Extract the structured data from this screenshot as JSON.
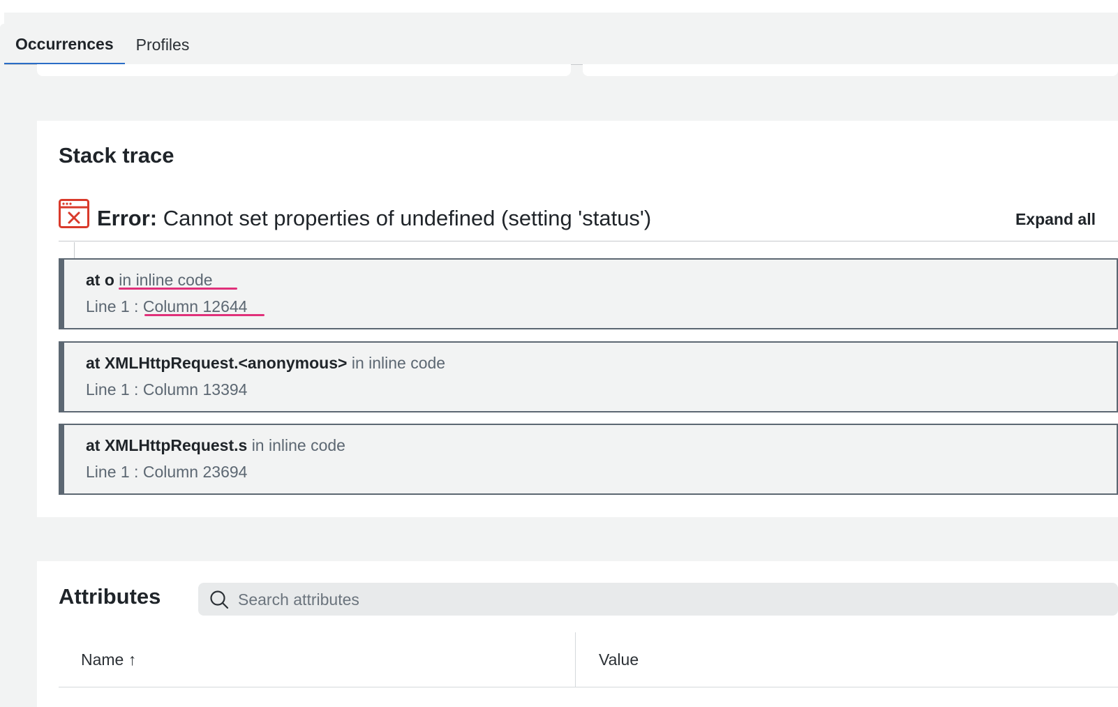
{
  "tabs": [
    {
      "label": "Occurrences",
      "active": true
    },
    {
      "label": "Profiles",
      "active": false
    }
  ],
  "stack_trace": {
    "title": "Stack trace",
    "error_prefix": "Error:",
    "error_message": "Cannot set properties of undefined (setting 'status')",
    "expand_all_label": "Expand all",
    "frames": [
      {
        "function": "at o",
        "location": "in inline code",
        "line_col": "Line 1 : Column 12644"
      },
      {
        "function": "at XMLHttpRequest.<anonymous>",
        "location": "in inline code",
        "line_col": "Line 1 : Column 13394"
      },
      {
        "function": "at XMLHttpRequest.s",
        "location": "in inline code",
        "line_col": "Line 1 : Column 23694"
      }
    ]
  },
  "attributes": {
    "title": "Attributes",
    "search_placeholder": "Search attributes",
    "columns": [
      "Name ↑",
      "Value"
    ]
  },
  "colors": {
    "tab_accent": "#2a6dc6",
    "error_icon": "#d93a2b",
    "annotation": "#e0307a",
    "frame_border": "#5c6772"
  },
  "icons": [
    "error-window-icon",
    "search-icon"
  ]
}
